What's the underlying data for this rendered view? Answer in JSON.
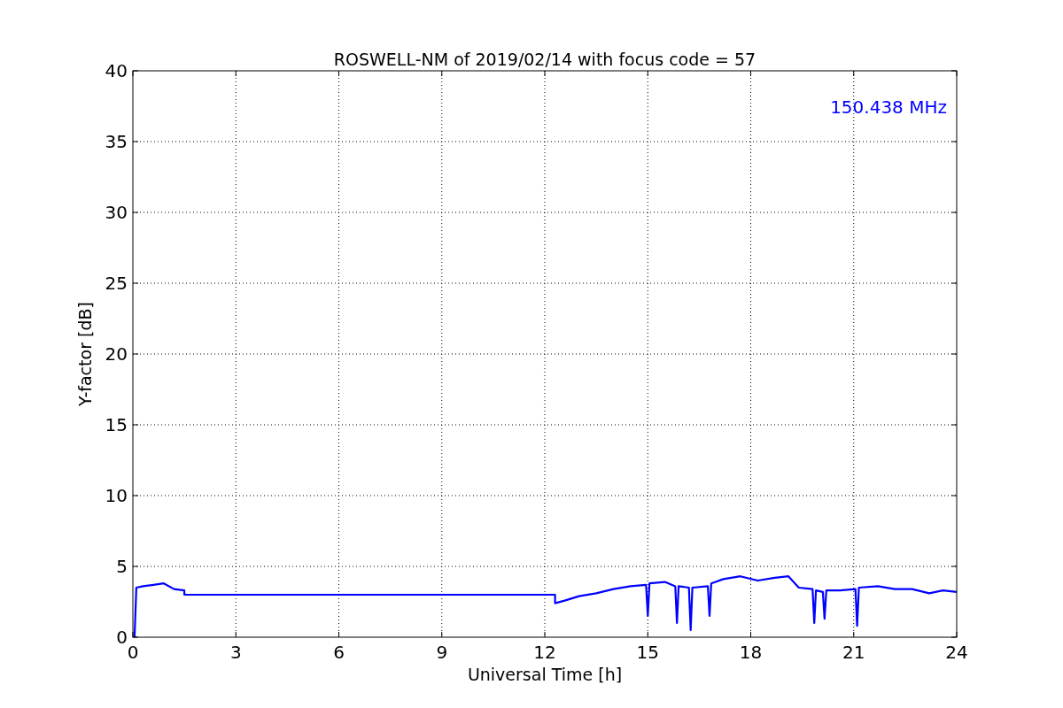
{
  "chart_data": {
    "type": "line",
    "title": "ROSWELL-NM of 2019/02/14 with focus code = 57",
    "xlabel": "Universal Time [h]",
    "ylabel": "Y-factor [dB]",
    "x": [
      0.05,
      0.1,
      0.3,
      0.6,
      0.9,
      1.2,
      1.5,
      1.5,
      12.3,
      12.3,
      12.6,
      13,
      13.5,
      14,
      14.5,
      14.95,
      15,
      15.05,
      15.5,
      15.8,
      15.85,
      15.9,
      16.2,
      16.25,
      16.3,
      16.75,
      16.8,
      16.85,
      17.2,
      17.7,
      18.2,
      18.7,
      19.1,
      19.4,
      19.8,
      19.85,
      19.9,
      20.1,
      20.15,
      20.2,
      20.6,
      21.05,
      21.1,
      21.15,
      21.7,
      22.2,
      22.7,
      23.2,
      23.6,
      24
    ],
    "series": [
      {
        "name": "150.438 MHz",
        "color": "#0000ff",
        "values": [
          0,
          3.5,
          3.6,
          3.7,
          3.8,
          3.4,
          3.3,
          3.0,
          3.0,
          2.4,
          2.6,
          2.9,
          3.1,
          3.4,
          3.6,
          3.7,
          1.5,
          3.8,
          3.9,
          3.6,
          1.0,
          3.6,
          3.5,
          0.5,
          3.5,
          3.6,
          1.5,
          3.8,
          4.1,
          4.3,
          4.0,
          4.2,
          4.3,
          3.5,
          3.4,
          1.0,
          3.3,
          3.2,
          1.3,
          3.3,
          3.3,
          3.4,
          0.8,
          3.5,
          3.6,
          3.4,
          3.4,
          3.1,
          3.3,
          3.2
        ]
      }
    ],
    "xlim": [
      0,
      24
    ],
    "ylim": [
      0,
      40
    ],
    "xticks": [
      0,
      3,
      6,
      9,
      12,
      15,
      18,
      21,
      24
    ],
    "yticks": [
      0,
      5,
      10,
      15,
      20,
      25,
      30,
      35,
      40
    ],
    "grid": true
  }
}
